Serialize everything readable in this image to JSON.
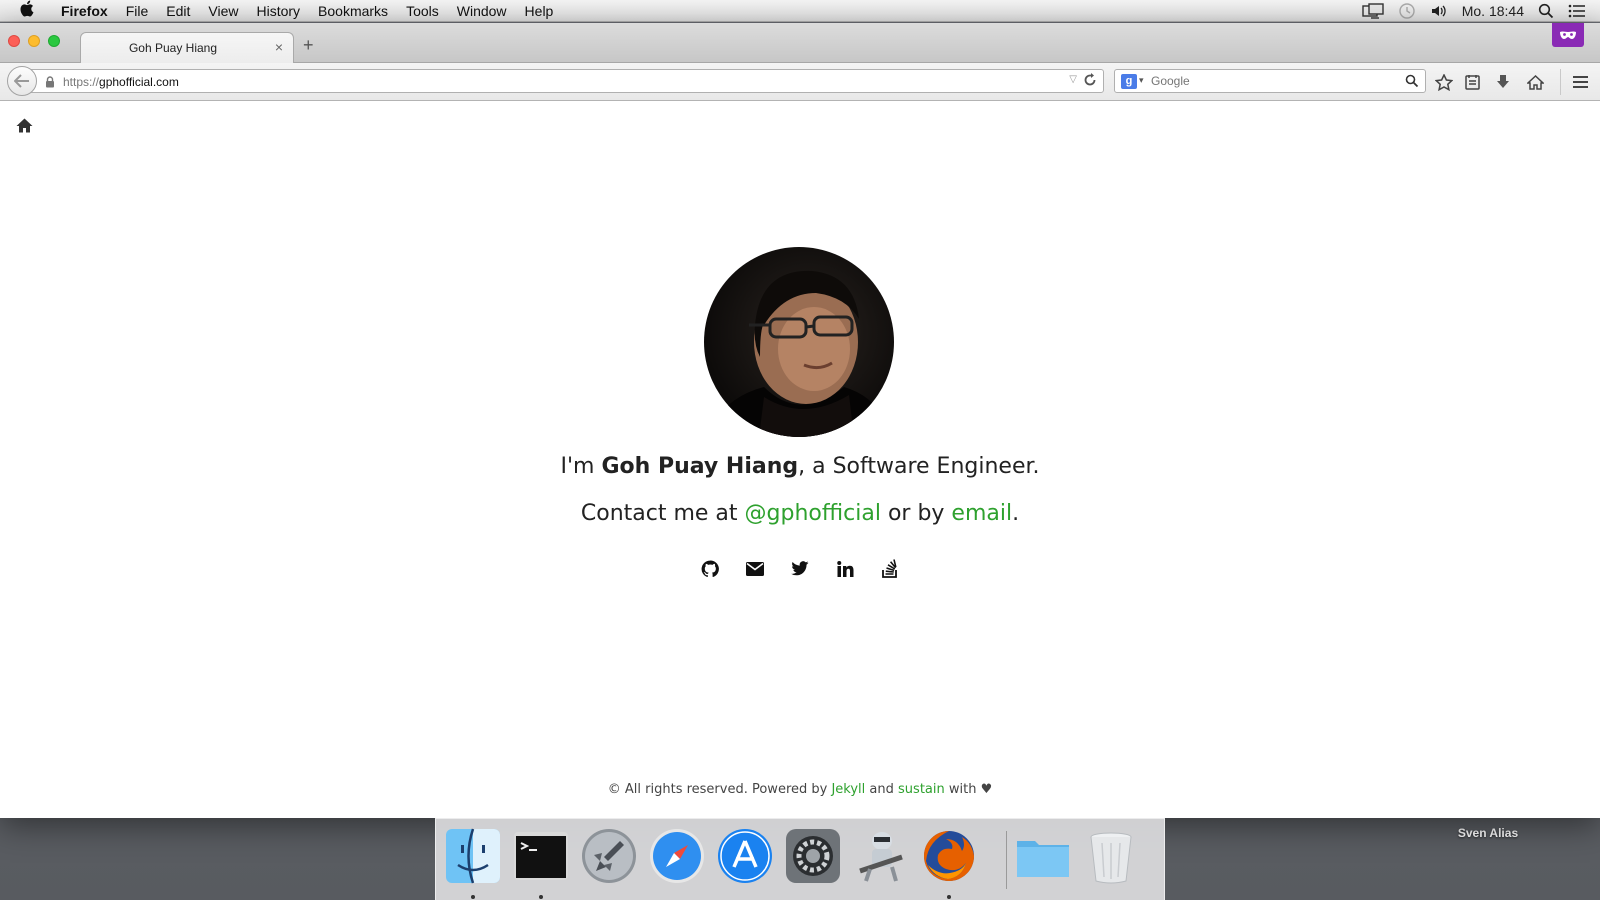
{
  "menubar": {
    "app_name": "Firefox",
    "menus": [
      "File",
      "Edit",
      "View",
      "History",
      "Bookmarks",
      "Tools",
      "Window",
      "Help"
    ],
    "clock": "Mo. 18:44"
  },
  "browser": {
    "tab_title": "Goh Puay Hiang",
    "url_protocol": "https://",
    "url_host": "gphofficial.com",
    "search_placeholder": "Google",
    "search_engine_letter": "g"
  },
  "page": {
    "intro_prefix": "I'm ",
    "intro_name": "Goh Puay Hiang",
    "intro_suffix": ", a Software Engineer.",
    "contact_prefix": "Contact me at ",
    "contact_handle": "@gphofficial",
    "contact_mid": " or by ",
    "contact_email_label": "email",
    "contact_end": ".",
    "social_links": [
      "github-icon",
      "email-icon",
      "twitter-icon",
      "linkedin-icon",
      "stackoverflow-icon"
    ],
    "footer_prefix": "© All rights reserved. Powered by ",
    "footer_jekyll": "Jekyll",
    "footer_and": " and ",
    "footer_sustain": "sustain",
    "footer_suffix": " with ♥",
    "link_color": "#2ea12e"
  },
  "dock": {
    "apps": [
      "Finder",
      "Terminal",
      "Launchpad",
      "Safari",
      "App Store",
      "System Preferences",
      "Automator",
      "Firefox",
      "Folder",
      "Trash"
    ]
  },
  "desktop": {
    "alias_label": "Sven Alias"
  }
}
